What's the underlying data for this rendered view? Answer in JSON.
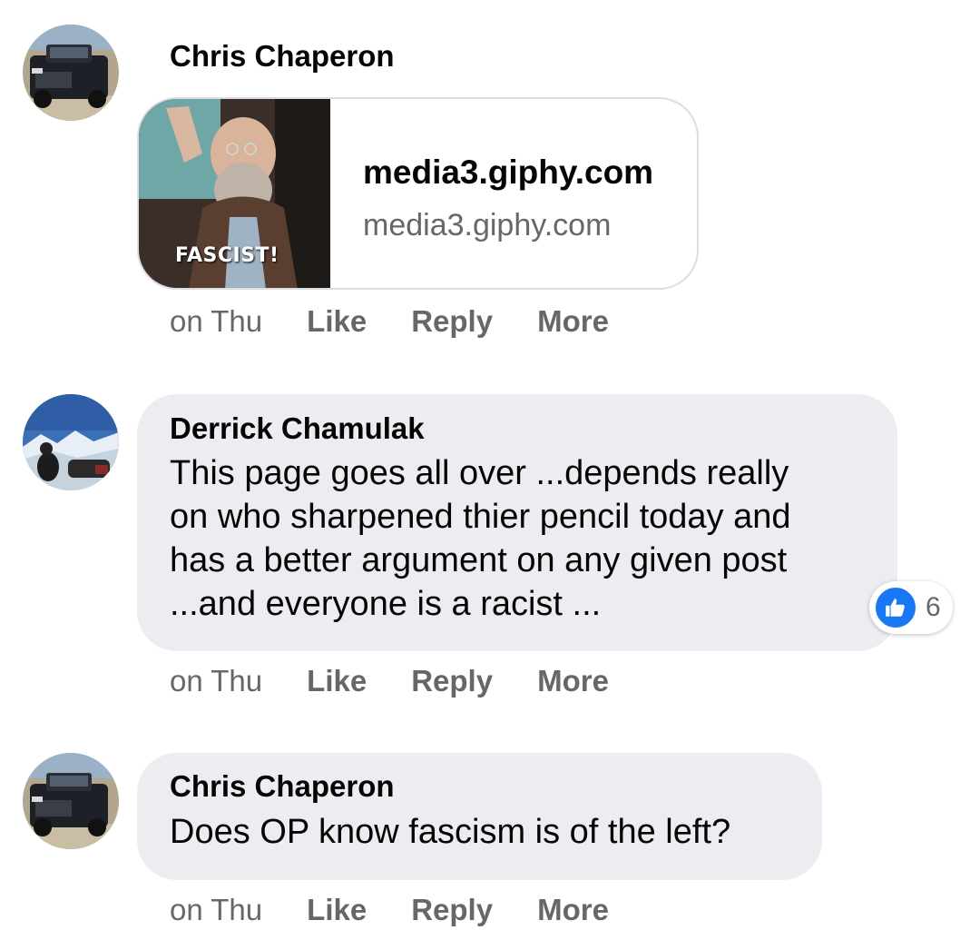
{
  "comments": [
    {
      "author": "Chris Chaperon",
      "link_preview": {
        "gif_caption": "FASCIST!",
        "title": "media3.giphy.com",
        "domain": "media3.giphy.com"
      },
      "time": "on Thu",
      "actions": {
        "like": "Like",
        "reply": "Reply",
        "more": "More"
      }
    },
    {
      "author": "Derrick Chamulak",
      "text": "This page goes all over ...depends really\non who sharpened thier pencil today and\nhas a better argument on any given post\n...and everyone is a racist ...",
      "reactions": {
        "icon": "like-icon",
        "count": "6"
      },
      "time": "on Thu",
      "actions": {
        "like": "Like",
        "reply": "Reply",
        "more": "More"
      }
    },
    {
      "author": "Chris Chaperon",
      "text": "Does OP know fascism is of the left?",
      "time": "on Thu",
      "actions": {
        "like": "Like",
        "reply": "Reply",
        "more": "More"
      }
    }
  ],
  "colors": {
    "bubble": "#ebedf0",
    "secondary_text": "#65676b",
    "like_blue": "#1877f2"
  }
}
